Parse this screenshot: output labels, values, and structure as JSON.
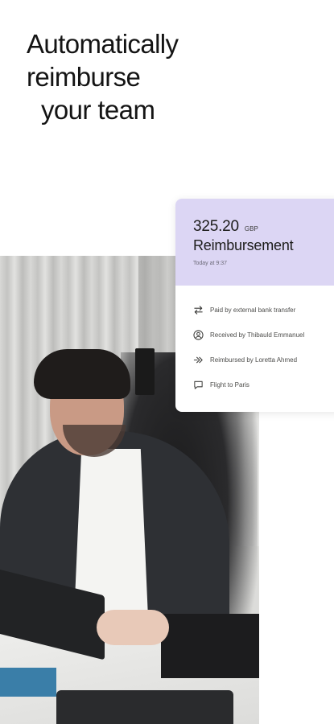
{
  "headline": {
    "line1": "Automatically",
    "line2": "reimburse",
    "line3": "your team"
  },
  "card": {
    "amount": "325.20",
    "currency": "GBP",
    "title": "Reimbursement",
    "subtitle": "Today at 9:37",
    "accent_color": "#dcd6f4",
    "rows": [
      {
        "icon": "transfer-arrows-icon",
        "label": "Paid by external bank transfer"
      },
      {
        "icon": "user-circle-icon",
        "label": "Received by Thibauld Emmanuel"
      },
      {
        "icon": "double-chevron-right-icon",
        "label": "Reimbursed by Loretta Ahmed"
      },
      {
        "icon": "comment-icon",
        "label": "Flight to Paris"
      }
    ]
  }
}
